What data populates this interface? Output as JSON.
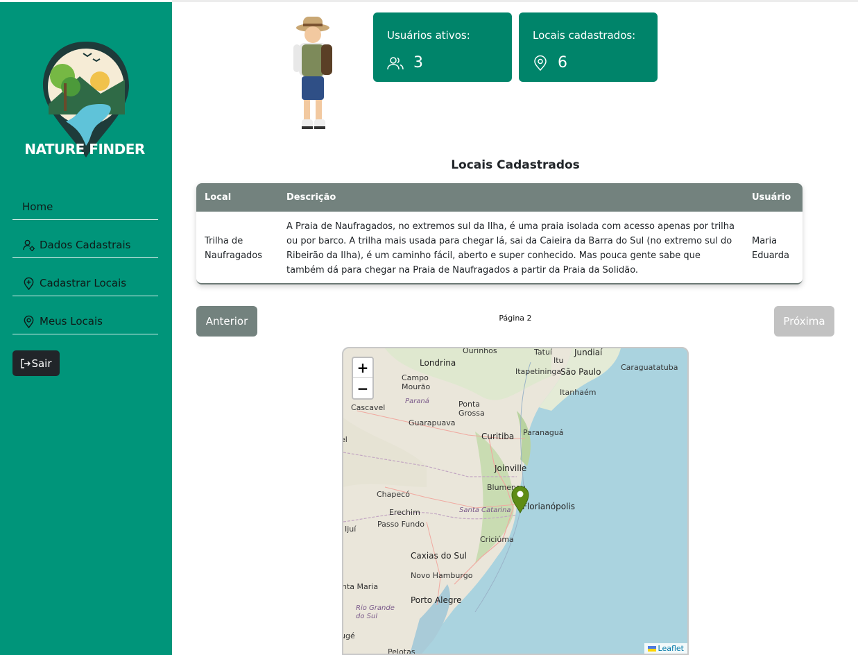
{
  "brand": {
    "name": "NATURE FINDER"
  },
  "sidebar": {
    "items": [
      {
        "label": "Home",
        "icon": ""
      },
      {
        "label": "Dados Cadastrais",
        "icon": "user-gear-icon"
      },
      {
        "label": "Cadastrar Locais",
        "icon": "map-pin-plus-icon"
      },
      {
        "label": "Meus Locais",
        "icon": "map-pin-icon"
      }
    ],
    "logout_label": "Sair"
  },
  "stats": {
    "users": {
      "label": "Usuários ativos:",
      "value": "3"
    },
    "places": {
      "label": "Locais cadastrados:",
      "value": "6"
    }
  },
  "section": {
    "title": "Locais Cadastrados"
  },
  "table": {
    "headers": {
      "local": "Local",
      "description": "Descrição",
      "user": "Usuário"
    },
    "rows": [
      {
        "local": "Trilha de Naufragados",
        "description": "A Praia de Naufragados, no extremos sul da Ilha, é uma praia isolada com acesso apenas por trilha ou por barco. A trilha mais usada para chegar lá, sai da Caieira da Barra do Sul (no extremo sul do Ribeirão da Ilha), é um caminho fácil, aberto e super conhecido. Mas pouca gente sabe que também dá para chegar na Praia de Naufragados a partir da Praia da Solidão.",
        "user": "Maria Eduarda"
      }
    ]
  },
  "pagination": {
    "prev_label": "Anterior",
    "page_label": "Página 2",
    "next_label": "Próxima"
  },
  "map": {
    "zoom_in": "+",
    "zoom_out": "−",
    "attribution": "Leaflet",
    "labels": {
      "ourinhos": "Ourinhos",
      "tatui": "Tatuí",
      "jundiai": "Jundiaí",
      "londrina": "Londrina",
      "itu": "Itu",
      "caraguatatuba": "Caraguatatuba",
      "campo_mourao": "Campo Mourão",
      "itapetininga": "Itapetininga",
      "sao_paulo": "São Paulo",
      "parana": "Paraná",
      "itanhaem": "Itanhaém",
      "ponta_grossa": "Ponta Grossa",
      "cascavel": "Cascavel",
      "guarapuava": "Guarapuava",
      "paranagua": "Paranaguá",
      "curitiba": "Curitiba",
      "joinville": "Joinville",
      "blumenau": "Blumenau",
      "chapeco": "Chapecó",
      "florianopolis": "Florianópolis",
      "erechim": "Erechim",
      "santa_catarina": "Santa Catarina",
      "passo_fundo": "Passo Fundo",
      "ijui": "Ijuí",
      "criciuma": "Criciúma",
      "caxias": "Caxias do Sul",
      "novo_hamburgo": "Novo Hamburgo",
      "santa_maria": "nta Maria",
      "porto_alegre": "Porto Alegre",
      "rio_grande_do_sul": "Rio Grande do Sul",
      "pelotas": "Pelotas",
      "ge": "ugé",
      "el": "el"
    }
  }
}
